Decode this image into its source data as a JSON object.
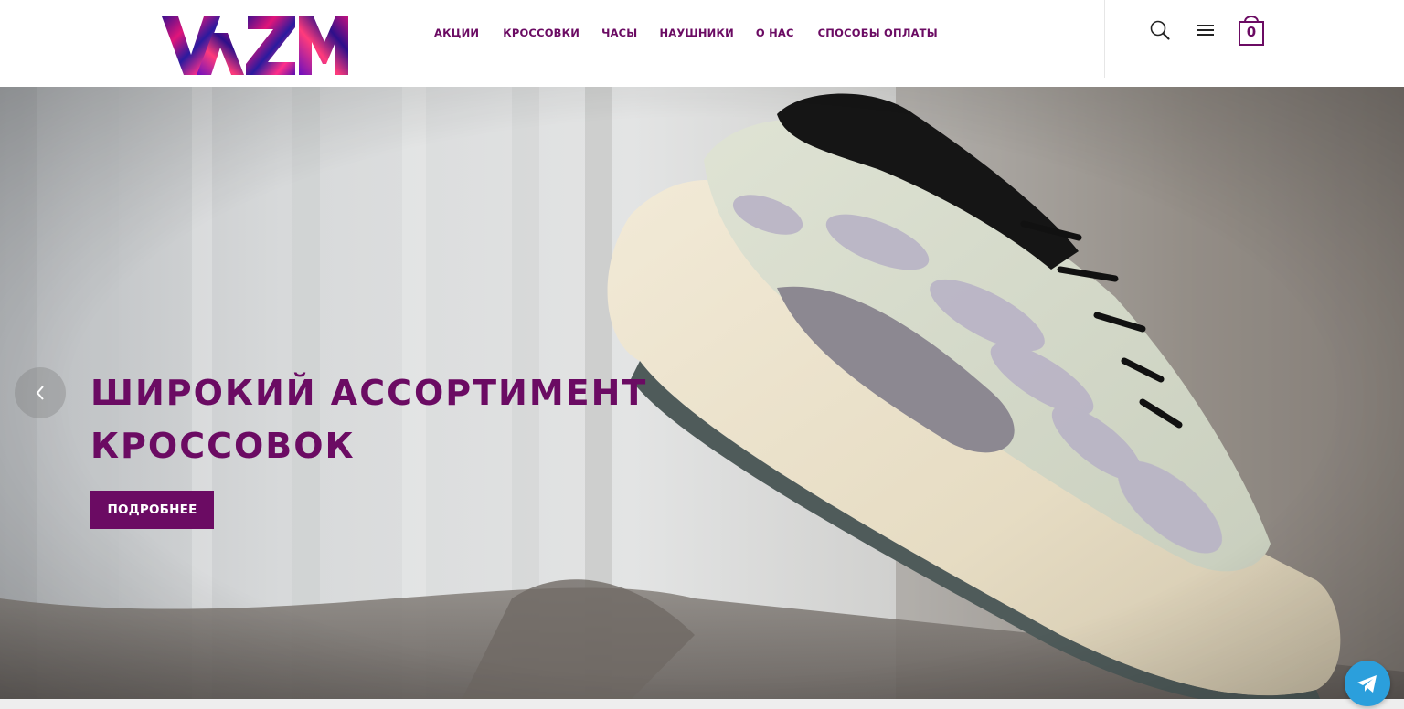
{
  "brand": {
    "logo_text": "VA ZM",
    "accent_color": "#6b0b63"
  },
  "nav": {
    "items": [
      {
        "label": "АКЦИИ"
      },
      {
        "label": "КРОССОВКИ"
      },
      {
        "label": "ЧАСЫ"
      },
      {
        "label": "НАУШНИКИ"
      },
      {
        "label": "О НАС"
      },
      {
        "label": "СПОСОБЫ ОПЛАТЫ"
      }
    ]
  },
  "header_icons": {
    "search": "search-icon",
    "menu": "hamburger-menu-icon",
    "cart": "shopping-bag-icon"
  },
  "cart": {
    "count": "0"
  },
  "hero": {
    "title_line1": "ШИРОКИЙ АССОРТИМЕНТ",
    "title_line2": "КРОССОВОК",
    "cta_label": "ПОДРОБНЕЕ",
    "prev_icon": "chevron-left-icon"
  },
  "chat_widget": {
    "icon": "telegram-icon",
    "color": "#2b9fdc"
  }
}
